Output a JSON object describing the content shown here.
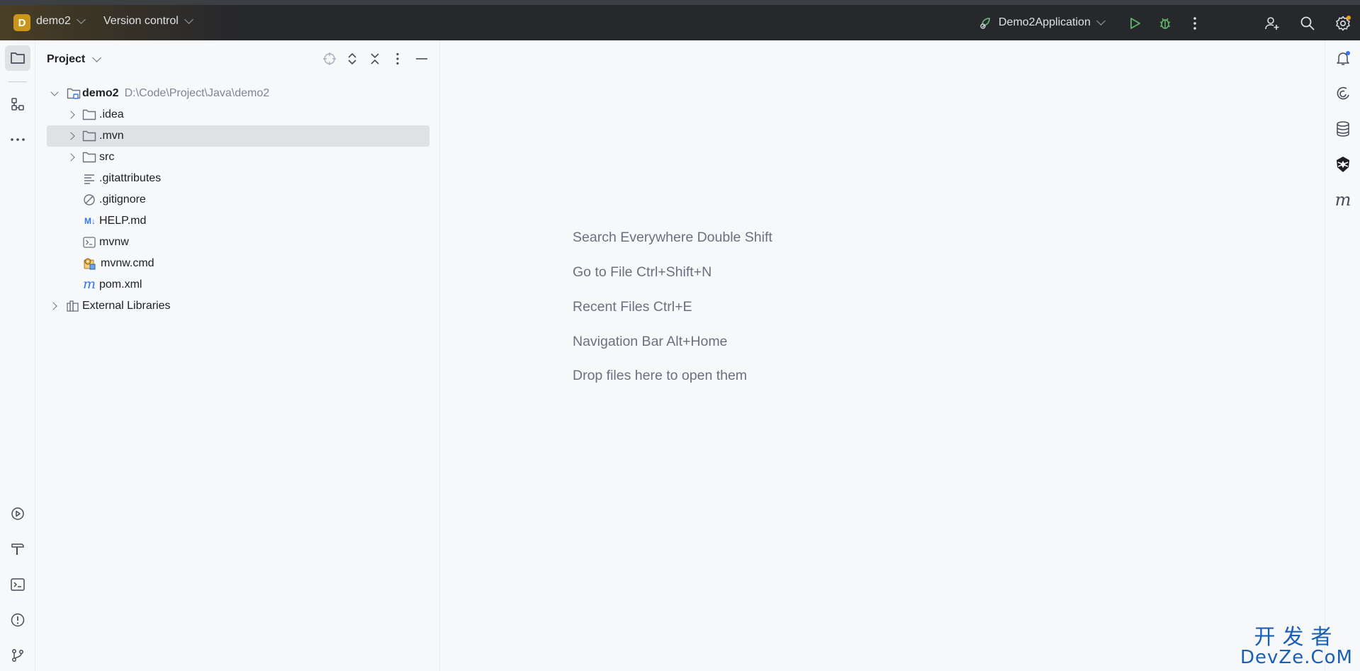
{
  "titlebar": {
    "project_badge": "D",
    "project_name": "demo2",
    "version_control": "Version control",
    "run_config": "Demo2Application"
  },
  "project_panel": {
    "title": "Project",
    "tree": [
      {
        "label": "demo2",
        "path": "D:\\Code\\Project\\Java\\demo2"
      },
      {
        "label": ".idea"
      },
      {
        "label": ".mvn"
      },
      {
        "label": "src"
      },
      {
        "label": ".gitattributes"
      },
      {
        "label": ".gitignore"
      },
      {
        "label": "HELP.md",
        "icon_text": "M↓"
      },
      {
        "label": "mvnw"
      },
      {
        "label": "mvnw.cmd"
      },
      {
        "label": "pom.xml",
        "icon_text": "m"
      },
      {
        "label": "External Libraries"
      }
    ]
  },
  "editor": {
    "hints": [
      "Search Everywhere Double Shift",
      "Go to File Ctrl+Shift+N",
      "Recent Files Ctrl+E",
      "Navigation Bar Alt+Home",
      "Drop files here to open them"
    ]
  },
  "right_strip": {
    "maven_glyph": "m"
  },
  "watermark": {
    "line1": "开发者",
    "line2": "DevZe.CoM"
  },
  "colors": {
    "accent": "#3574f0",
    "run_green": "#499c54",
    "badge": "#c9961a",
    "selection": "#dfe1e5"
  }
}
